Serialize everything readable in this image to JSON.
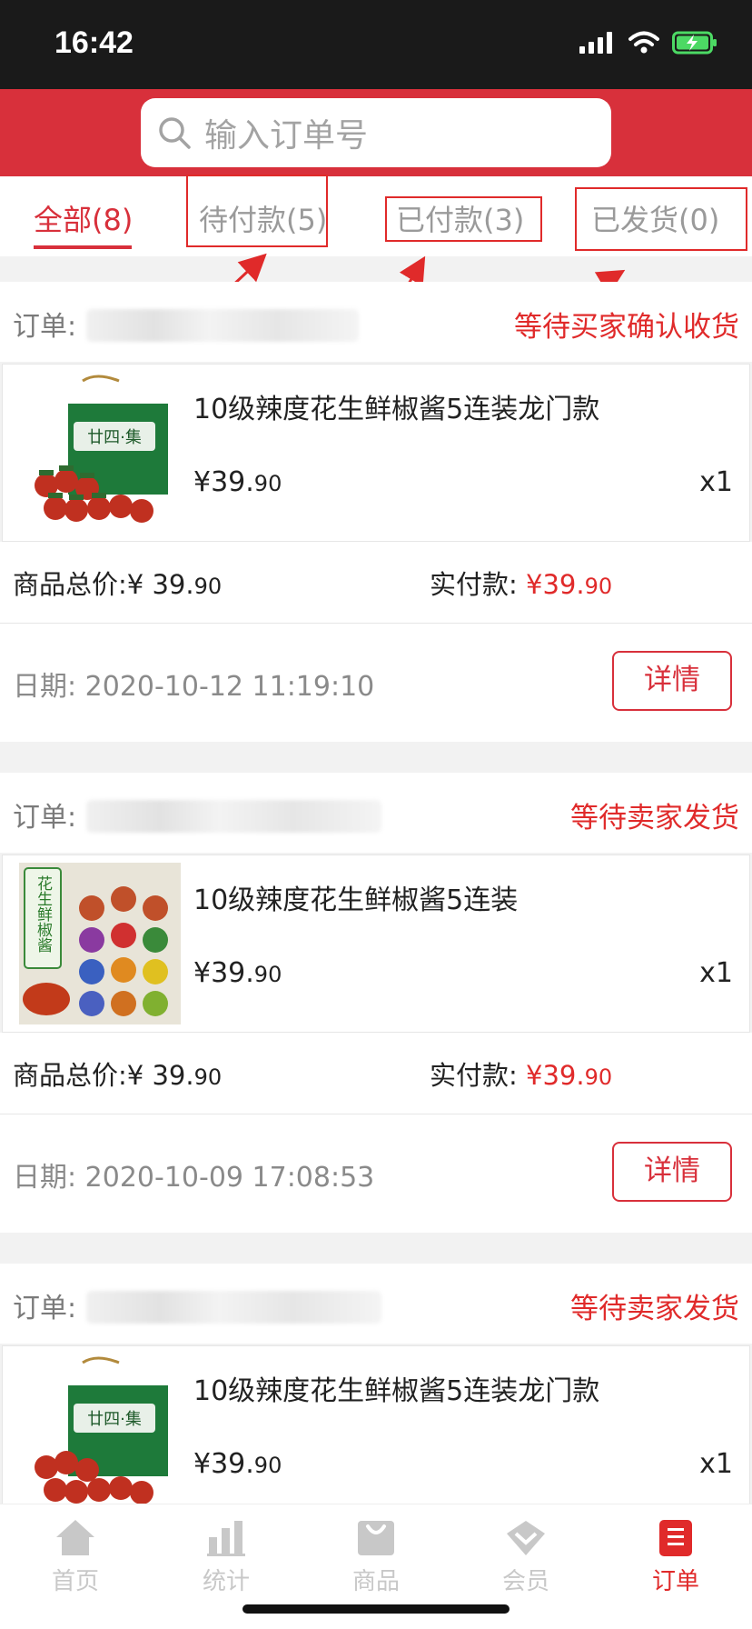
{
  "status_bar": {
    "time": "16:42"
  },
  "search": {
    "placeholder": "输入订单号"
  },
  "tabs": [
    {
      "label": "全部(8)",
      "active": true
    },
    {
      "label": "待付款(5)",
      "active": false
    },
    {
      "label": "已付款(3)",
      "active": false
    },
    {
      "label": "已发货(0)",
      "active": false
    }
  ],
  "orders": [
    {
      "order_label": "订单:",
      "status": "等待买家确认收货",
      "product_name": "10级辣度花生鲜椒酱5连装龙门款",
      "price_main": "¥39.",
      "price_cents": "90",
      "qty": "x1",
      "total_label": "商品总价:¥ 39.",
      "total_cents": "90",
      "paid_label": "实付款: ",
      "paid_main": "¥39.",
      "paid_cents": "90",
      "date": "日期:  2020-10-12 11:19:10",
      "detail_button": "详情",
      "thumb_text": "廿四·集"
    },
    {
      "order_label": "订单:",
      "status": "等待卖家发货",
      "product_name": "10级辣度花生鲜椒酱5连装",
      "price_main": "¥39.",
      "price_cents": "90",
      "qty": "x1",
      "total_label": "商品总价:¥ 39.",
      "total_cents": "90",
      "paid_label": "实付款: ",
      "paid_main": "¥39.",
      "paid_cents": "90",
      "date": "日期:  2020-10-09 17:08:53",
      "detail_button": "详情",
      "thumb_text": "花生鲜椒酱"
    },
    {
      "order_label": "订单:",
      "status": "等待卖家发货",
      "product_name": "10级辣度花生鲜椒酱5连装龙门款",
      "price_main": "¥39.",
      "price_cents": "90",
      "qty": "x1",
      "thumb_text": "廿四·集"
    }
  ],
  "tabbar": [
    {
      "label": "首页",
      "icon": "home-icon"
    },
    {
      "label": "统计",
      "icon": "chart-icon"
    },
    {
      "label": "商品",
      "icon": "bag-icon"
    },
    {
      "label": "会员",
      "icon": "member-icon"
    },
    {
      "label": "订单",
      "icon": "order-icon",
      "active": true
    }
  ],
  "colors": {
    "brand": "#d8303b",
    "status_red": "#e02a2a",
    "annotation": "#e02a2a"
  }
}
